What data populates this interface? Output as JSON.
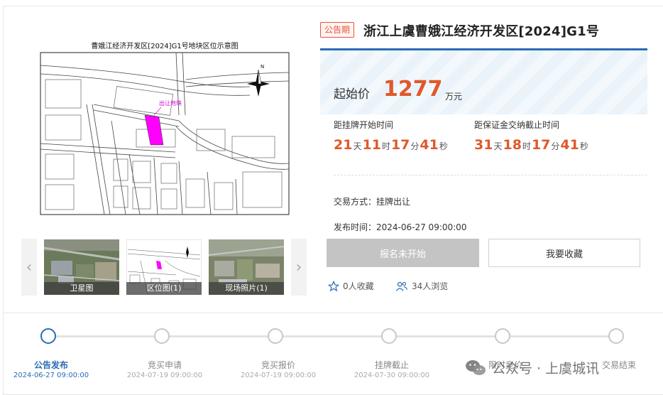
{
  "map": {
    "caption": "曹娥江经济开发区[2024]G1号地块区位示意图",
    "parcel_label": "出让地块",
    "north": "N",
    "parcel_color": "#ff00ff"
  },
  "thumbs": [
    {
      "label": "卫星图"
    },
    {
      "label": "区位图(1)"
    },
    {
      "label": "现场照片(1)"
    }
  ],
  "nav": {
    "prev": "‹",
    "next": "›"
  },
  "header": {
    "badge": "公告期",
    "title": "浙江上虞曹娥江经济开发区[2024]G1号"
  },
  "price": {
    "label": "起始价",
    "value": "1277",
    "unit": "万元"
  },
  "countdown_listing": {
    "label": "距挂牌开始时间",
    "days": "21",
    "d": "天",
    "hours": "11",
    "h": "时",
    "minutes": "17",
    "m": "分",
    "seconds": "41",
    "s": "秒"
  },
  "countdown_deposit": {
    "label": "距保证金交纳截止时间",
    "days": "31",
    "d": "天",
    "hours": "18",
    "h": "时",
    "minutes": "17",
    "m": "分",
    "seconds": "41",
    "s": "秒"
  },
  "details": {
    "trade_mode": "交易方式：挂牌出让",
    "publish_time": "发布时间：2024-06-27 09:00:00"
  },
  "buttons": {
    "apply": "报名未开始",
    "favorite": "我要收藏"
  },
  "stats": {
    "favorites": "0人收藏",
    "views": "34人浏览"
  },
  "steps": [
    {
      "label": "公告发布",
      "date": "2024-06-27 09:00:00",
      "active": true
    },
    {
      "label": "竞买申请",
      "date": "2024-07-19 09:00:00",
      "active": false
    },
    {
      "label": "竞买报价",
      "date": "2024-07-19 09:00:00",
      "active": false
    },
    {
      "label": "挂牌截止",
      "date": "2024-07-30 09:00:00",
      "active": false
    },
    {
      "label": "限时竞价",
      "date": "",
      "active": false
    },
    {
      "label": "交易结束",
      "date": "",
      "active": false
    }
  ],
  "watermark": "公众号 · 上虞城讯",
  "colors": {
    "accent": "#2b6bb5",
    "price": "#e0582b",
    "badge": "#e8533f"
  }
}
